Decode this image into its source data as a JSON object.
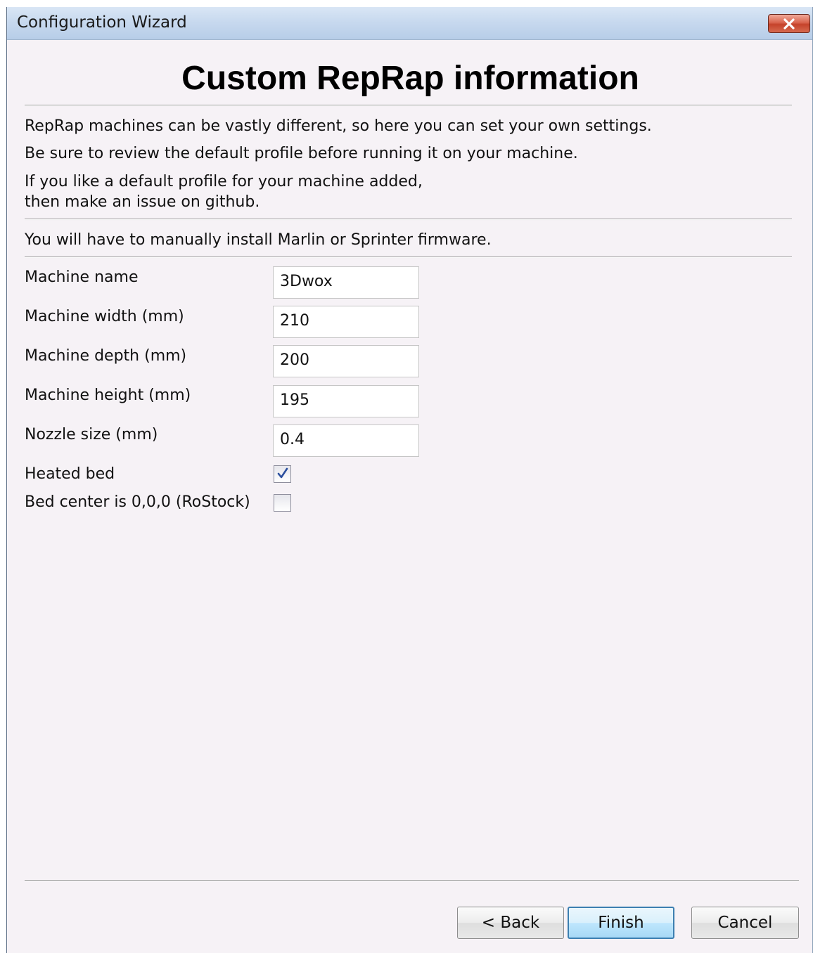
{
  "window": {
    "title": "Configuration Wizard"
  },
  "page": {
    "heading": "Custom RepRap information",
    "intro_line1": "RepRap machines can be vastly different, so here you can set your own settings.",
    "intro_line2": "Be sure to review the default profile before running it on your machine.",
    "intro_line3": "If you like a default profile for your machine added,\nthen make an issue on github.",
    "firmware_note": "You will have to manually install Marlin or Sprinter firmware."
  },
  "form": {
    "machine_name": {
      "label": "Machine name",
      "value": "3Dwox"
    },
    "machine_width": {
      "label": "Machine width (mm)",
      "value": "210"
    },
    "machine_depth": {
      "label": "Machine depth (mm)",
      "value": "200"
    },
    "machine_height": {
      "label": "Machine height (mm)",
      "value": "195"
    },
    "nozzle_size": {
      "label": "Nozzle size (mm)",
      "value": "0.4"
    },
    "heated_bed": {
      "label": "Heated bed",
      "checked": true
    },
    "bed_center": {
      "label": "Bed center is 0,0,0 (RoStock)",
      "checked": false
    }
  },
  "buttons": {
    "back": "< Back",
    "finish": "Finish",
    "cancel": "Cancel"
  },
  "icons": {
    "close": "close-icon",
    "check": "checkmark-icon"
  },
  "colors": {
    "titlebar": "#c6d8ee",
    "close_button": "#d9644d",
    "dialog_background": "#f6f2f6",
    "default_button_border": "#3c7fb1"
  }
}
